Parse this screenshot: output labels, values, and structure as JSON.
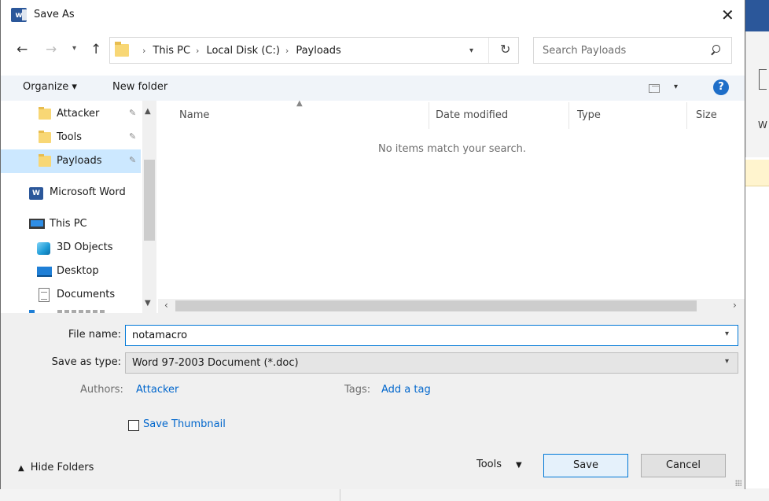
{
  "window": {
    "title": "Save As",
    "close_glyph": "✕"
  },
  "background_app": {
    "ribbon_letter": "W"
  },
  "navigation": {
    "back_glyph": "←",
    "forward_glyph": "→",
    "recent_glyph": "⌄",
    "up_glyph": "↑",
    "breadcrumbs": [
      "This PC",
      "Local Disk (C:)",
      "Payloads"
    ],
    "crumb_sep": "›",
    "dropdown_glyph": "⌄",
    "refresh_glyph": "↻"
  },
  "search": {
    "placeholder": "Search Payloads"
  },
  "commandbar": {
    "organize_label": "Organize ▾",
    "new_folder_label": "New folder",
    "view_dropdown_glyph": "▾",
    "help_glyph": "?"
  },
  "nav_pane": {
    "items": [
      {
        "label": "Attacker",
        "icon": "folder-icon",
        "pinned": true
      },
      {
        "label": "Tools",
        "icon": "folder-icon",
        "pinned": true
      },
      {
        "label": "Payloads",
        "icon": "folder-icon",
        "pinned": true,
        "selected": true
      },
      {
        "label": "Microsoft Word",
        "icon": "word-icon"
      },
      {
        "label": "This PC",
        "icon": "computer-icon"
      },
      {
        "label": "3D Objects",
        "icon": "3d-objects-icon"
      },
      {
        "label": "Desktop",
        "icon": "desktop-icon"
      },
      {
        "label": "Documents",
        "icon": "documents-icon"
      }
    ],
    "pin_glyph": "📌"
  },
  "file_list": {
    "columns": [
      "Name",
      "Date modified",
      "Type",
      "Size"
    ],
    "empty_message": "No items match your search."
  },
  "form": {
    "file_name_label": "File name:",
    "file_name_value": "notamacro",
    "save_as_type_label": "Save as type:",
    "save_as_type_value": "Word 97-2003 Document (*.doc)",
    "authors_label": "Authors:",
    "authors_value": "Attacker",
    "tags_label": "Tags:",
    "tags_value": "Add a tag",
    "save_thumbnail_label": "Save Thumbnail",
    "save_thumbnail_checked": false,
    "hide_folders_label": "Hide Folders",
    "tools_label": "Tools",
    "save_button": "Save",
    "cancel_button": "Cancel"
  },
  "colors": {
    "accent": "#0078d7",
    "link": "#0066cc",
    "selected_bg": "#cce8ff",
    "word_blue": "#2b579a",
    "folder_yellow": "#f8d775"
  }
}
